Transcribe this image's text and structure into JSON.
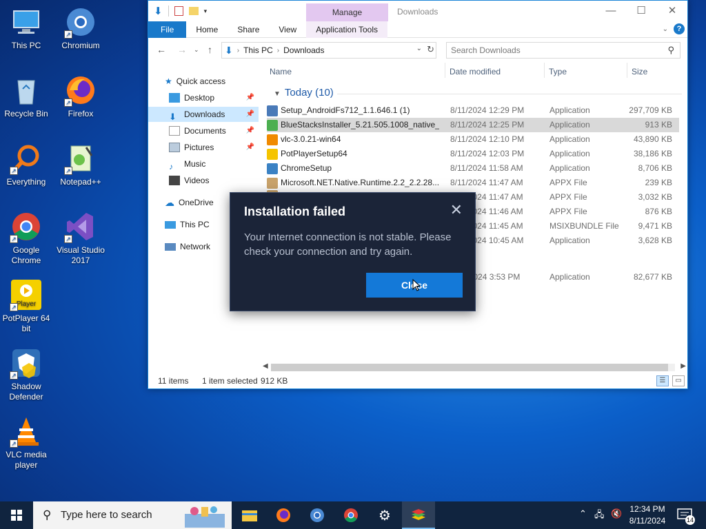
{
  "desktop": {
    "icons": [
      {
        "label": "This PC",
        "icon": "computer-icon"
      },
      {
        "label": "Chromium",
        "icon": "chromium-icon"
      },
      {
        "label": "Recycle Bin",
        "icon": "recycle-bin-icon"
      },
      {
        "label": "Firefox",
        "icon": "firefox-icon"
      },
      {
        "label": "Everything",
        "icon": "everything-search-icon"
      },
      {
        "label": "Notepad++",
        "icon": "notepad-plus-plus-icon"
      },
      {
        "label": "Google Chrome",
        "icon": "chrome-icon"
      },
      {
        "label": "Visual Studio 2017",
        "icon": "visual-studio-icon"
      },
      {
        "label": "PotPlayer 64 bit",
        "icon": "potplayer-icon"
      },
      {
        "label": "Shadow Defender",
        "icon": "shadow-defender-icon"
      },
      {
        "label": "VLC media player",
        "icon": "vlc-icon"
      }
    ]
  },
  "explorer": {
    "title": "Downloads",
    "manage_tab": "Manage",
    "ribbon_tabs": [
      "File",
      "Home",
      "Share",
      "View",
      "Application Tools"
    ],
    "address": {
      "crumbs": [
        "This PC",
        "Downloads"
      ]
    },
    "search_placeholder": "Search Downloads",
    "nav": {
      "quick_access": "Quick access",
      "items": [
        "Desktop",
        "Downloads",
        "Documents",
        "Pictures",
        "Music",
        "Videos"
      ],
      "onedrive": "OneDrive",
      "this_pc": "This PC",
      "network": "Network"
    },
    "columns": {
      "name": "Name",
      "date": "Date modified",
      "type": "Type",
      "size": "Size"
    },
    "group": "Today (10)",
    "files": [
      {
        "name": "Setup_AndroidFs712_1.1.646.1 (1)",
        "date": "8/11/2024 12:29 PM",
        "type": "Application",
        "size": "297,709 KB",
        "color": "#4a7ab8"
      },
      {
        "name": "BlueStacksInstaller_5.21.505.1008_native_...",
        "date": "8/11/2024 12:25 PM",
        "type": "Application",
        "size": "913 KB",
        "color": "#4caf50"
      },
      {
        "name": "vlc-3.0.21-win64",
        "date": "8/11/2024 12:10 PM",
        "type": "Application",
        "size": "43,890 KB",
        "color": "#f08a00"
      },
      {
        "name": "PotPlayerSetup64",
        "date": "8/11/2024 12:03 PM",
        "type": "Application",
        "size": "38,186 KB",
        "color": "#f5c400"
      },
      {
        "name": "ChromeSetup",
        "date": "8/11/2024 11:58 AM",
        "type": "Application",
        "size": "8,706 KB",
        "color": "#3b82c4"
      },
      {
        "name": "Microsoft.NET.Native.Runtime.2.2_2.2.28...",
        "date": "8/11/2024 11:47 AM",
        "type": "APPX File",
        "size": "239 KB",
        "color": "#c9a36b"
      },
      {
        "name": "",
        "date": "8/11/2024 11:47 AM",
        "type": "APPX File",
        "size": "3,032 KB",
        "color": "#c9a36b"
      },
      {
        "name": "",
        "date": "8/11/2024 11:46 AM",
        "type": "APPX File",
        "size": "876 KB",
        "color": "#c9a36b"
      },
      {
        "name": "",
        "date": "8/11/2024 11:45 AM",
        "type": "MSIXBUNDLE File",
        "size": "9,471 KB",
        "color": "#c9a36b"
      },
      {
        "name": "",
        "date": "8/11/2024 10:45 AM",
        "type": "Application",
        "size": "3,628 KB",
        "color": "#888888"
      }
    ],
    "older_file": {
      "name": "",
      "date": "8/10/2024 3:53 PM",
      "type": "Application",
      "size": "82,677 KB"
    },
    "status": {
      "items": "11 items",
      "selected": "1 item selected",
      "size": "912 KB"
    }
  },
  "dialog": {
    "title": "Installation failed",
    "message": "Your Internet connection is not stable. Please check your connection and try again.",
    "button": "Close"
  },
  "taskbar": {
    "search_placeholder": "Type here to search",
    "time": "12:34 PM",
    "date": "8/11/2024",
    "notifications": "14"
  },
  "colors": {
    "accent": "#1979ca",
    "dialog_bg": "#1b2438",
    "dialog_button": "#1479d8",
    "taskbar": "#10243f"
  }
}
